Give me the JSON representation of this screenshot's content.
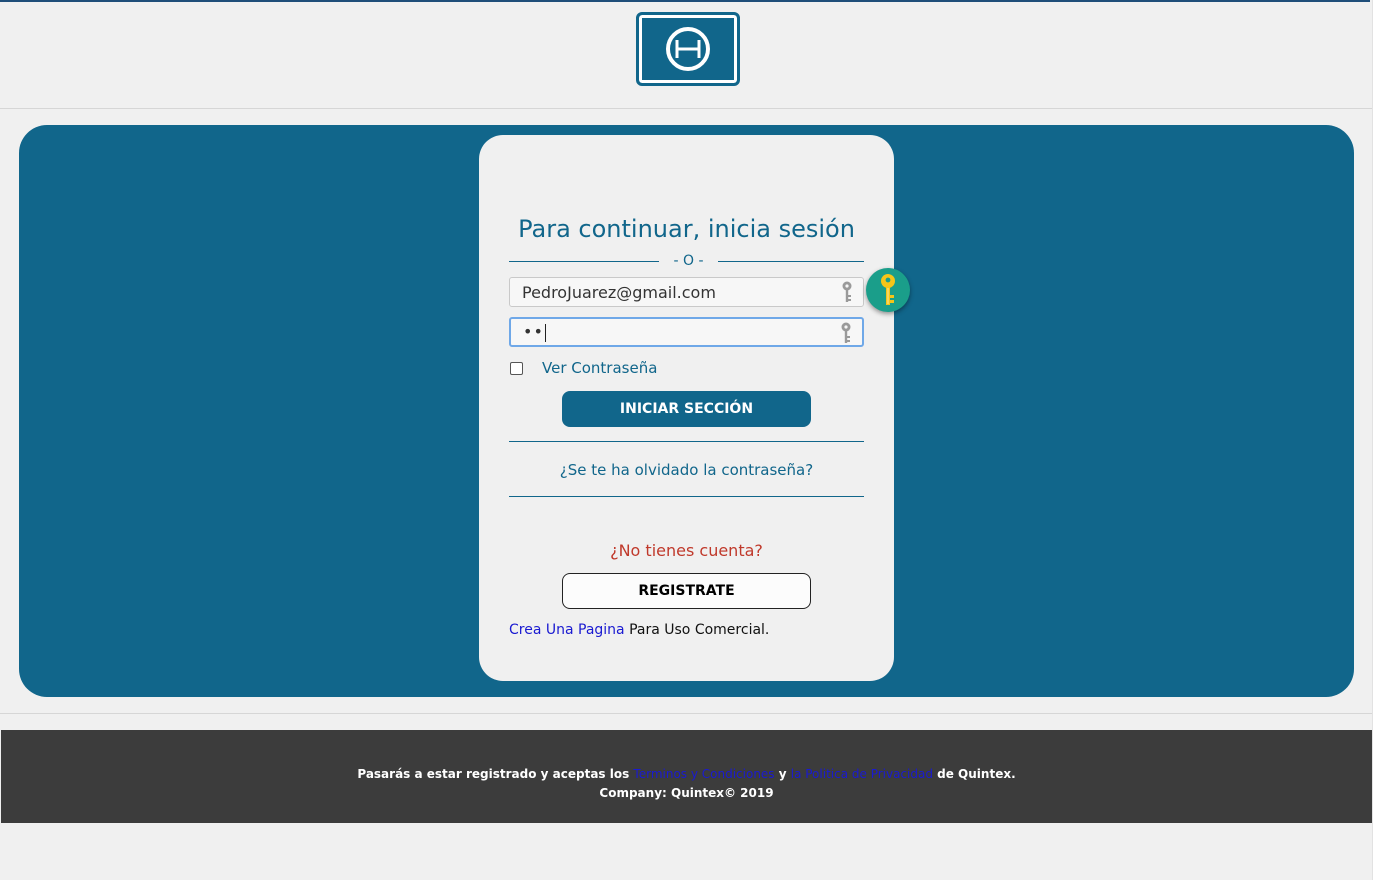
{
  "colors": {
    "brand": "#11668b",
    "card_bg": "#f0f0f0",
    "error_text": "#c0392b",
    "link": "#1a1ad1",
    "footer_bg": "#3c3c3c",
    "key_badge": "#1a9e8a"
  },
  "header": {
    "logo_icon": "theta-logo-icon"
  },
  "login": {
    "title": "Para continuar, inicia sesión",
    "divider_text": "- O -",
    "email_value": "PedroJuarez@gmail.com",
    "password_value": "••",
    "email_icon": "key-icon",
    "password_icon": "key-icon",
    "show_password_label": "Ver Contraseña",
    "show_password_checked": false,
    "login_button": "INICIAR SECCIÓN",
    "forgot_link": "¿Se te ha olvidado la contraseña?",
    "no_account": "¿No tienes cuenta?",
    "register_button": "REGISTRATE",
    "commercial_link": "Crea Una Pagina",
    "commercial_text": " Para Uso Comercial."
  },
  "password_manager": {
    "icon": "golden-key-icon"
  },
  "footer": {
    "prefix": "Pasarás a estar registrado y aceptas los ",
    "terms_link": "Terminos y Condiciones",
    "and": " y ",
    "privacy_link": "la Politica de Privacidad",
    "suffix": " de Quintex.",
    "company": "Company: Quintex© 2019"
  }
}
